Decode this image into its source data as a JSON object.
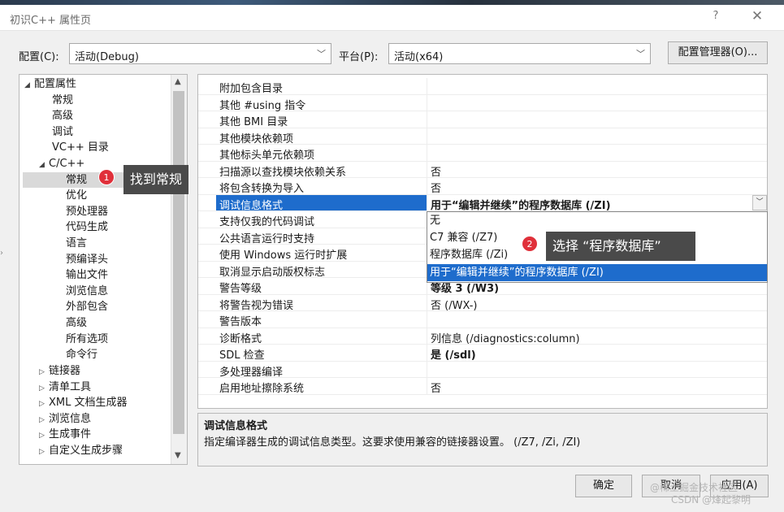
{
  "window": {
    "title": "初识C++ 属性页",
    "help": "?",
    "close": "✕"
  },
  "config": {
    "config_label": "配置(C):",
    "config_value": "活动(Debug)",
    "platform_label": "平台(P):",
    "platform_value": "活动(x64)",
    "manager_button": "配置管理器(O)..."
  },
  "tree": {
    "items": [
      {
        "label": "配置属性",
        "toggle": "◢"
      },
      {
        "label": "常规"
      },
      {
        "label": "高级"
      },
      {
        "label": "调试"
      },
      {
        "label": "VC++ 目录"
      },
      {
        "label": "C/C++",
        "toggle": "◢"
      },
      {
        "label": "常规",
        "selected": true
      },
      {
        "label": "优化"
      },
      {
        "label": "预处理器"
      },
      {
        "label": "代码生成"
      },
      {
        "label": "语言"
      },
      {
        "label": "预编译头"
      },
      {
        "label": "输出文件"
      },
      {
        "label": "浏览信息"
      },
      {
        "label": "外部包含"
      },
      {
        "label": "高级"
      },
      {
        "label": "所有选项"
      },
      {
        "label": "命令行"
      },
      {
        "label": "链接器",
        "toggle": "▷"
      },
      {
        "label": "清单工具",
        "toggle": "▷"
      },
      {
        "label": "XML 文档生成器",
        "toggle": "▷"
      },
      {
        "label": "浏览信息",
        "toggle": "▷"
      },
      {
        "label": "生成事件",
        "toggle": "▷"
      },
      {
        "label": "自定义生成步骤",
        "toggle": "▷"
      }
    ]
  },
  "grid": {
    "rows": [
      {
        "name": "附加包含目录",
        "value": ""
      },
      {
        "name": "其他 #using 指令",
        "value": ""
      },
      {
        "name": "其他 BMI 目录",
        "value": ""
      },
      {
        "name": "其他模块依赖项",
        "value": ""
      },
      {
        "name": "其他标头单元依赖项",
        "value": ""
      },
      {
        "name": "扫描源以查找模块依赖关系",
        "value": "否"
      },
      {
        "name": "将包含转换为导入",
        "value": "否"
      },
      {
        "name": "调试信息格式",
        "value": "用于“编辑并继续”的程序数据库 (/ZI)",
        "selected": true
      },
      {
        "name": "支持仅我的代码调试",
        "value": ""
      },
      {
        "name": "公共语言运行时支持",
        "value": ""
      },
      {
        "name": "使用 Windows 运行时扩展",
        "value": ""
      },
      {
        "name": "取消显示启动版权标志",
        "value": ""
      },
      {
        "name": "警告等级",
        "value": "等级 3 (/W3)"
      },
      {
        "name": "将警告视为错误",
        "value": "否 (/WX-)"
      },
      {
        "name": "警告版本",
        "value": ""
      },
      {
        "name": "诊断格式",
        "value": "列信息 (/diagnostics:column)"
      },
      {
        "name": "SDL 检查",
        "value": "是 (/sdl)"
      },
      {
        "name": "多处理器编译",
        "value": ""
      },
      {
        "name": "启用地址擦除系统",
        "value": "否"
      }
    ]
  },
  "dropdown": {
    "options": [
      {
        "label": "无"
      },
      {
        "label": "C7 兼容 (/Z7)"
      },
      {
        "label": "程序数据库 (/Zi)"
      },
      {
        "label": "用于“编辑并继续”的程序数据库 (/ZI)",
        "selected": true
      }
    ]
  },
  "description": {
    "title": "调试信息格式",
    "text": "指定编译器生成的调试信息类型。这要求使用兼容的链接器设置。 (/Z7, /Zi, /ZI)"
  },
  "footer": {
    "ok": "确定",
    "cancel": "取消",
    "apply": "应用(A)"
  },
  "annotations": {
    "badge1": "1",
    "callout1": "找到常规",
    "badge2": "2",
    "callout2": "选择 “程序数据库”",
    "watermark1": "@稀土掘金技术社区",
    "watermark2": "CSDN @烽起黎明"
  }
}
